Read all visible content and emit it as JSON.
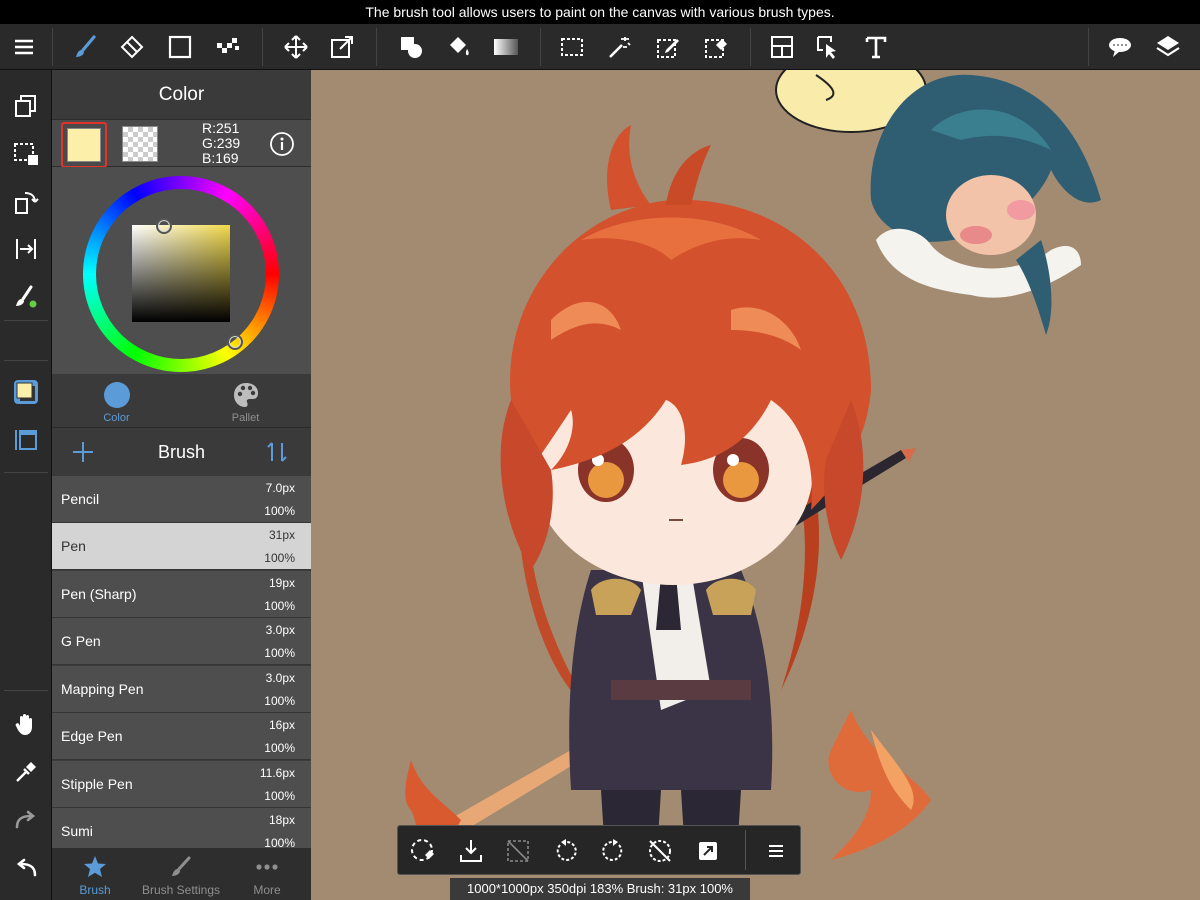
{
  "tooltip": "The brush tool allows users to paint on the canvas with various brush types.",
  "color_panel": {
    "title": "Color",
    "main_color": "#fbefa9",
    "rgb": {
      "r": "R:251",
      "g": "G:239",
      "b": "B:169"
    },
    "tabs": [
      {
        "label": "Color",
        "icon": "circle-icon",
        "active": true
      },
      {
        "label": "Pallet",
        "icon": "palette-icon",
        "active": false
      }
    ]
  },
  "brush_panel": {
    "title": "Brush",
    "brushes": [
      {
        "name": "Pencil",
        "size": "7.0px",
        "opacity": "100%",
        "selected": false
      },
      {
        "name": "Pen",
        "size": "31px",
        "opacity": "100%",
        "selected": true
      },
      {
        "name": "Pen (Sharp)",
        "size": "19px",
        "opacity": "100%",
        "selected": false
      },
      {
        "name": "G Pen",
        "size": "3.0px",
        "opacity": "100%",
        "selected": false
      },
      {
        "name": "Mapping Pen",
        "size": "3.0px",
        "opacity": "100%",
        "selected": false
      },
      {
        "name": "Edge Pen",
        "size": "16px",
        "opacity": "100%",
        "selected": false
      },
      {
        "name": "Stipple Pen",
        "size": "11.6px",
        "opacity": "100%",
        "selected": false
      },
      {
        "name": "Sumi",
        "size": "18px",
        "opacity": "100%",
        "selected": false
      }
    ]
  },
  "bottom_tabs": [
    {
      "label": "Brush",
      "icon": "star-icon",
      "active": true
    },
    {
      "label": "Brush Settings",
      "icon": "brush-settings-icon",
      "active": false
    },
    {
      "label": "More",
      "icon": "more-icon",
      "active": false
    }
  ],
  "status": "1000*1000px 350dpi 183% Brush: 31px 100%",
  "colors": {
    "accent": "#5b9bd8",
    "canvas_bg": "#a38b72",
    "selected_row": "#d4d4d4",
    "swatch_border": "#e0332a"
  }
}
